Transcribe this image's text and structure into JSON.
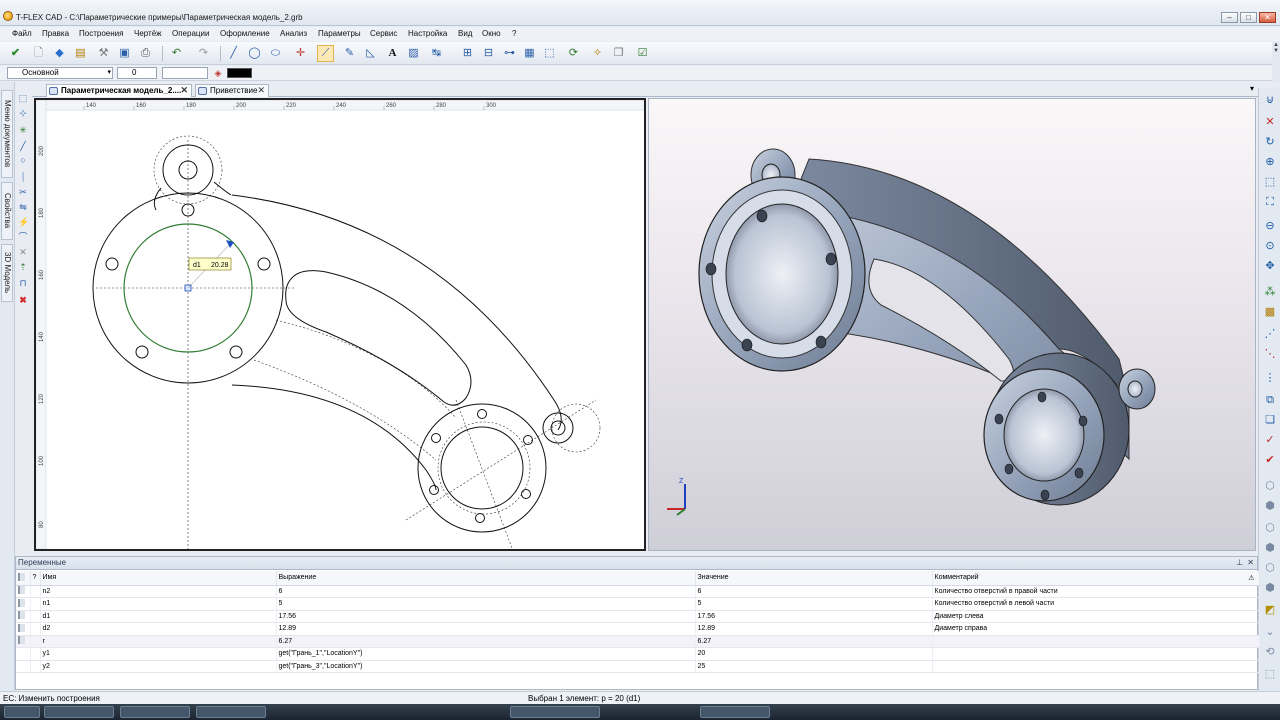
{
  "window": {
    "title": "T-FLEX CAD - C:\\Параметрические примеры\\Параметрическая модель_2.grb",
    "controls": {
      "minimize": "‒",
      "maximize": "□",
      "close": "✕"
    }
  },
  "menu": [
    "Файл",
    "Правка",
    "Построения",
    "Чертёж",
    "Операции",
    "Оформление",
    "Анализ",
    "Параметры",
    "Сервис",
    "Настройка",
    "Вид",
    "Окно",
    "?"
  ],
  "propbar": {
    "layer": "Основной",
    "level": "0"
  },
  "side_tabs": [
    "Меню документов",
    "Свойства",
    "3D Модель"
  ],
  "tabs": [
    {
      "label": "Параметрическая модель_2....",
      "close": "✕"
    },
    {
      "label": "Приветствие",
      "close": "✕"
    }
  ],
  "drawing": {
    "ruler_top": [
      "140",
      "160",
      "180",
      "200",
      "220",
      "240",
      "260",
      "280",
      "300"
    ],
    "ruler_left": [
      "200",
      "180",
      "160",
      "140",
      "120",
      "100",
      "80"
    ],
    "dimension_tooltip": {
      "name": "d1",
      "value": "20.28"
    }
  },
  "axes_3d": {
    "z": "Z"
  },
  "variables": {
    "title": "Переменные",
    "columns": {
      "flag": "?",
      "name": "Имя",
      "expression": "Выражение",
      "value": "Значение",
      "comment": "Комментарий"
    },
    "rows": [
      {
        "name": "n2",
        "expression": "6",
        "value": "6",
        "comment": "Количество отверстий в правой части"
      },
      {
        "name": "n1",
        "expression": "5",
        "value": "5",
        "comment": "Количество отверстий в левой части"
      },
      {
        "name": "d1",
        "expression": "17.56",
        "value": "17.56",
        "comment": "Диаметр слева"
      },
      {
        "name": "d2",
        "expression": "12.89",
        "value": "12.89",
        "comment": "Диаметр справа"
      },
      {
        "name": "r",
        "expression": "6.27",
        "value": "6.27",
        "comment": ""
      },
      {
        "name": "y1",
        "expression": "get(\"Грань_1\",\"LocationY\")",
        "value": "20",
        "comment": ""
      },
      {
        "name": "y2",
        "expression": "get(\"Грань_3\",\"LocationY\")",
        "value": "25",
        "comment": ""
      }
    ]
  },
  "status": {
    "left": "ЕС: Изменить построения",
    "center": "Выбран 1 элемент: p = 20 (d1)"
  },
  "colors": {
    "accent": "#1c5ba8",
    "sketch_green": "#2e7d32",
    "model_metal": "#9aa7bd"
  }
}
